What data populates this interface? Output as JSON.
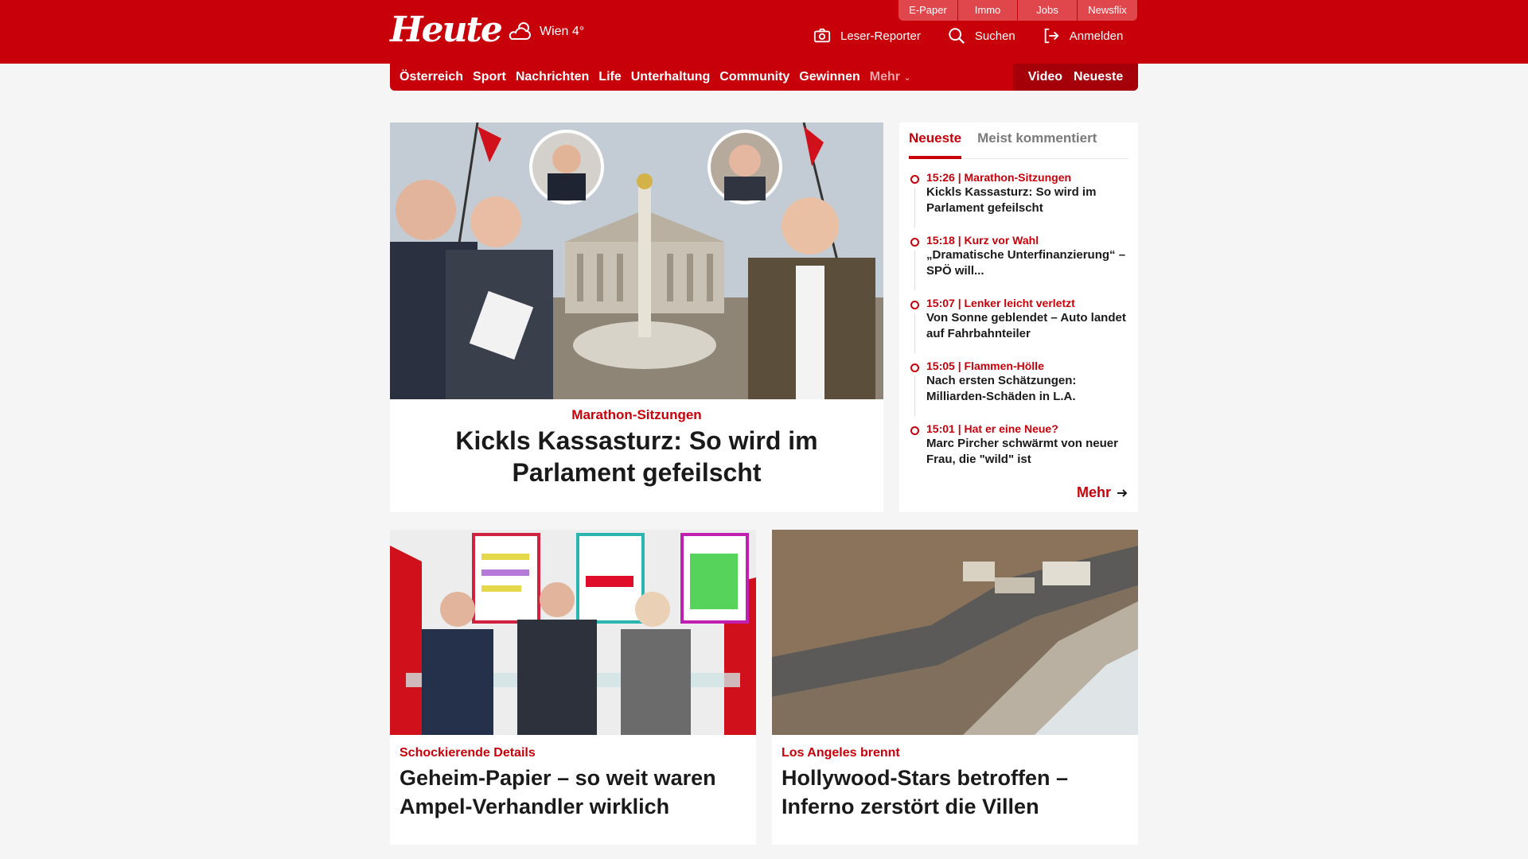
{
  "header": {
    "logo": "Heute",
    "weather": "Wien 4°",
    "service_links": [
      "E-Paper",
      "Immo",
      "Jobs",
      "Newsflix"
    ],
    "actions": {
      "reporter": "Leser-Reporter",
      "search": "Suchen",
      "login": "Anmelden"
    }
  },
  "nav": {
    "items": [
      "Österreich",
      "Sport",
      "Nachrichten",
      "Life",
      "Unterhaltung",
      "Community",
      "Gewinnen"
    ],
    "more": "Mehr",
    "right": [
      "Video",
      "Neueste"
    ]
  },
  "hero": {
    "kicker": "Marathon-Sitzungen",
    "title": "Kickls Kassasturz: So wird im Parlament gefeilscht"
  },
  "sidebar": {
    "tabs": [
      "Neueste",
      "Meist kommentiert"
    ],
    "items": [
      {
        "meta": "15:26 | Marathon-Sitzungen",
        "title": "Kickls Kassasturz: So wird im Parlament gefeilscht"
      },
      {
        "meta": "15:18 | Kurz vor Wahl",
        "title": "„Dramatische Unterfinanzierung“ – SPÖ will..."
      },
      {
        "meta": "15:07 | Lenker leicht verletzt",
        "title": "Von Sonne geblendet – Auto landet auf Fahrbahnteiler"
      },
      {
        "meta": "15:05 | Flammen-Hölle",
        "title": "Nach ersten Schätzungen: Milliarden-Schäden in L.A."
      },
      {
        "meta": "15:01 | Hat er eine Neue?",
        "title": "Marc Pircher schwärmt von neuer Frau, die \"wild\" ist"
      }
    ],
    "more": "Mehr"
  },
  "cards": [
    {
      "kicker": "Schockierende Details",
      "title": "Geheim-Papier – so weit waren Ampel-Verhandler wirklich"
    },
    {
      "kicker": "Los Angeles brennt",
      "title": "Hollywood-Stars betroffen – Inferno zerstört die Villen"
    }
  ]
}
